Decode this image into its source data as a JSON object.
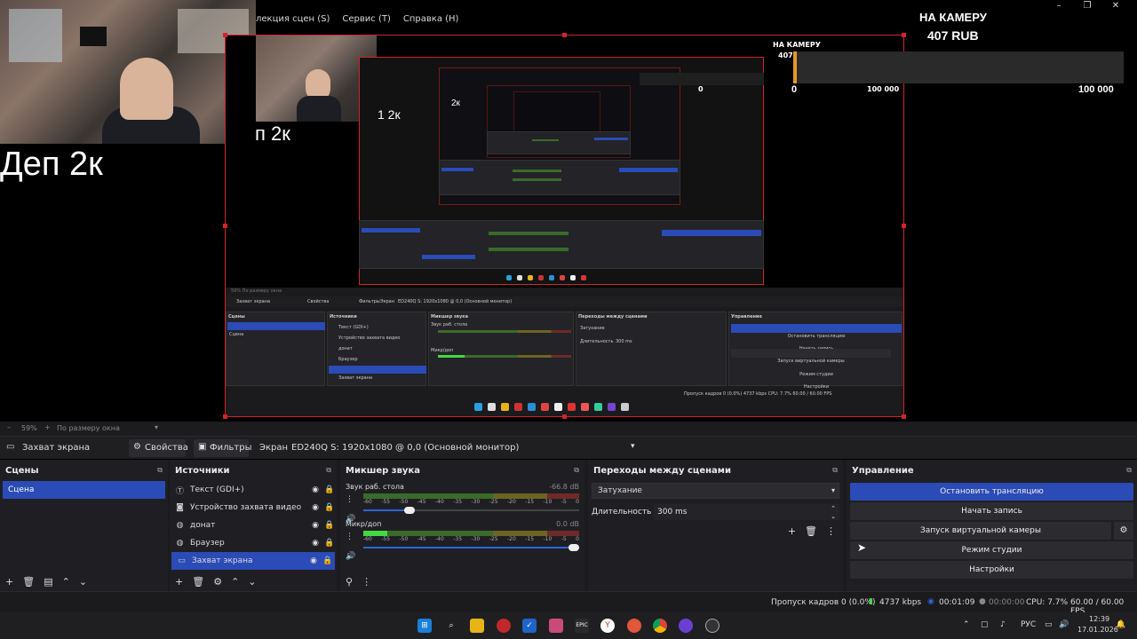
{
  "menu": [
    "лекция сцен (S)",
    "Сервис (T)",
    "Справка (H)"
  ],
  "window_controls": {
    "minimize": "–",
    "maximize": "❐",
    "close": "✕"
  },
  "overlay": {
    "big_text": "Деп 2к",
    "mid_text": "п 2к",
    "small_text": "1 2к",
    "xs_text": "2к",
    "donation_title": "НА КАМЕРУ",
    "donation_amount": "407 RUB",
    "goal_min": "0",
    "goal_max": "100 000",
    "goal_progress": 0.004,
    "nested_title": "НА КАМЕРУ",
    "nested_amount": "407",
    "nested_min": "0",
    "nested_max": "100 000"
  },
  "mini_obs": {
    "menu": [
      "лекция сцен (S)",
      "Сервис (T)",
      "Справка (H)"
    ],
    "scale": "59%",
    "fit": "По размеру окна",
    "source_name": "Захват экрана",
    "properties": "Свойства",
    "filters": "Фильтры",
    "screen_label": "Экран",
    "screen_value": "ED240Q S: 1920x1080 @ 0,0 (Основной монитор)",
    "docks": [
      "Сцены",
      "Источники",
      "Микшер звука",
      "Переходы между сценами",
      "Управление"
    ],
    "scene": "Сцена",
    "sources": [
      "Текст (GDI+)",
      "Устройство захвата видео",
      "донат",
      "Браузер",
      "Захват экрана"
    ],
    "mixer": [
      "Звук раб. стола",
      "Микр/доп"
    ],
    "transition": "Затухание",
    "duration_label": "Длительность",
    "duration_value": "300 ms",
    "controls": [
      "Остановить трансляцию",
      "Начать запись",
      "Запуск виртуальной камеры",
      "Режим студии",
      "Настройки"
    ],
    "status": "Пропуск кадров 0 (0.0%)   4737 kbps   CPU: 7.7%   60.00 / 60.00 FPS"
  },
  "scale_bar": {
    "zoom": "59%",
    "fit_mode": "По размеру окна"
  },
  "toolbar": {
    "source_name": "Захват экрана",
    "properties_label": "Свойства",
    "filters_label": "Фильтры",
    "screen_label": "Экран",
    "screen_value": "ED240Q S: 1920x1080 @ 0,0 (Основной монитор)"
  },
  "scenes": {
    "title": "Сцены",
    "items": [
      "Сцена"
    ],
    "selected": 0
  },
  "sources": {
    "title": "Источники",
    "items": [
      {
        "label": "Текст (GDI+)",
        "icon": "text-icon"
      },
      {
        "label": "Устройство захвата видео",
        "icon": "camera-icon"
      },
      {
        "label": "донат",
        "icon": "globe-icon"
      },
      {
        "label": "Браузер",
        "icon": "globe-icon"
      },
      {
        "label": "Захват экрана",
        "icon": "monitor-icon"
      }
    ],
    "selected": 4
  },
  "mixer": {
    "title": "Микшер звука",
    "ticks": [
      "-60",
      "-55",
      "-50",
      "-45",
      "-40",
      "-35",
      "-30",
      "-25",
      "-20",
      "-15",
      "-10",
      "-5",
      "0"
    ],
    "channels": [
      {
        "name": "Звук раб. стола",
        "db": "-66.8 dB",
        "level": 0.0,
        "volume": 0.2
      },
      {
        "name": "Микр/доп",
        "db": "0.0 dB",
        "level": 0.11,
        "volume": 1.0
      }
    ]
  },
  "transitions": {
    "title": "Переходы между сценами",
    "selected": "Затухание",
    "duration_label": "Длительность",
    "duration_value": "300 ms"
  },
  "controls": {
    "title": "Управление",
    "stop_stream": "Остановить трансляцию",
    "start_record": "Начать запись",
    "virtual_cam": "Запуск виртуальной камеры",
    "studio_mode": "Режим студии",
    "settings": "Настройки"
  },
  "status": {
    "dropped": "Пропуск кадров 0 (0.0%)",
    "bitrate": "4737 kbps",
    "stream_time": "00:01:09",
    "record_time": "00:00:00",
    "cpu": "CPU: 7.7%",
    "fps": "60.00 / 60.00 FPS"
  },
  "taskbar": {
    "lang": "РУС",
    "time": "12:39",
    "date": "17.01.2026",
    "apps": [
      "windows-start-icon",
      "search-icon",
      "folder-icon",
      "app-red-icon",
      "checkmark-app-icon",
      "obs-app-icon",
      "epic-games-icon",
      "yandex-browser-icon",
      "app-orange-icon",
      "chrome-icon",
      "app-purple-icon",
      "obs-icon"
    ]
  },
  "colors": {
    "accent": "#2b4bb6",
    "selection_border": "#d2232a",
    "goal_fill": "#e8962a"
  }
}
